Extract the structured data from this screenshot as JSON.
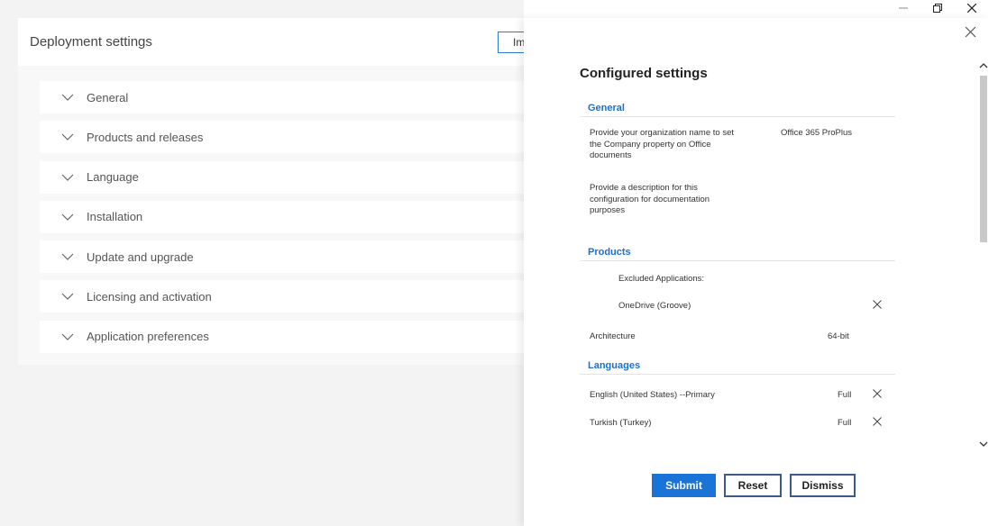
{
  "main": {
    "title": "Deployment settings",
    "import_label": "Im",
    "sections": [
      {
        "label": "General"
      },
      {
        "label": "Products and releases"
      },
      {
        "label": "Language"
      },
      {
        "label": "Installation"
      },
      {
        "label": "Update and upgrade"
      },
      {
        "label": "Licensing and activation"
      },
      {
        "label": "Application preferences"
      }
    ]
  },
  "panel": {
    "title": "Configured settings",
    "general": {
      "heading": "General",
      "org_label": "Provide your organization name to set the Company property on Office documents",
      "org_value": "Office 365 ProPlus",
      "desc_label": "Provide a description for this configuration for documentation purposes"
    },
    "products": {
      "heading": "Products",
      "excluded_label": "Excluded Applications:",
      "excluded_item": "OneDrive (Groove)",
      "arch_label": "Architecture",
      "arch_value": "64-bit"
    },
    "languages": {
      "heading": "Languages",
      "items": [
        {
          "label": "English (United States) --Primary",
          "value": "Full"
        },
        {
          "label": "Turkish (Turkey)",
          "value": "Full"
        }
      ]
    },
    "buttons": {
      "submit": "Submit",
      "reset": "Reset",
      "dismiss": "Dismiss"
    }
  },
  "colors": {
    "accent": "#1a73d6",
    "heading_blue": "#1e6fc8"
  }
}
